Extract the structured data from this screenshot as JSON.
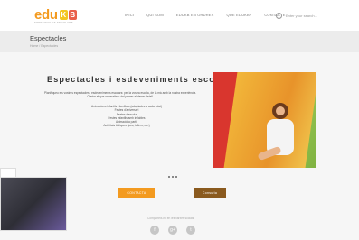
{
  "logo": {
    "edu": "edu",
    "k": "K",
    "b": "B",
    "tagline": "ESPECTACLES ESCOLARS"
  },
  "nav": [
    "INICI",
    "QUI SOM",
    "EDUKB EN ORDRES",
    "QUE EDUKB?",
    "CONTACTE"
  ],
  "search": {
    "placeholder": "Enter your search..."
  },
  "page": {
    "title": "Espectacles",
    "breadcrumb": "Home  /  Espectacles"
  },
  "main": {
    "heading": "Espectacles i esdeveniments escolars",
    "intro": "Planifiqueu els vostres espectacles i esdeveniments escolars: per la vostra escola, de la mà amb la nostra experiència. Oferim el que necessiteu: del primer al darrer detall.",
    "items": [
      "Animacions infantils i familiars (adaptades a cada edat)",
      "Festes d'aniversari",
      "Festes d'escola",
      "Festes infantils amb inflables",
      "Animació a partir",
      "Activitats lúdiques (jocs, tallers, etc.)"
    ]
  },
  "buttons": {
    "contacta": "CONTACTA",
    "consulta": "Consulta"
  },
  "share": {
    "label": "Comparteix-ho en les xarxes socials"
  },
  "socials": [
    "f",
    "g+",
    "t"
  ]
}
